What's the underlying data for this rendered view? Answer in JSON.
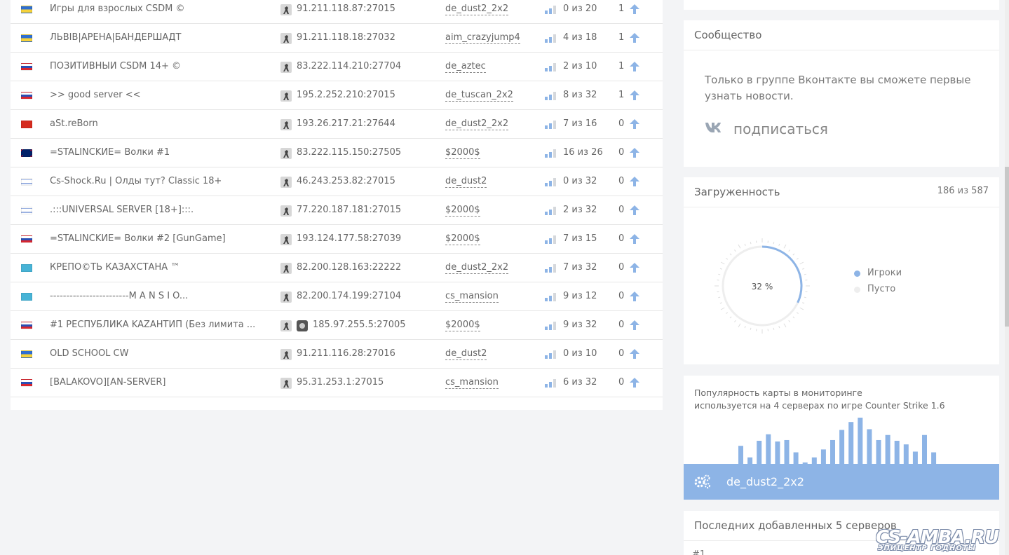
{
  "servers": [
    {
      "flag": "ua",
      "name": "Игры для взрослых CSDM ©",
      "ip": "91.211.118.87:27015",
      "map": "de_dust2_2x2",
      "players": "0 из 20",
      "rating": "1",
      "steam": false
    },
    {
      "flag": "ua",
      "name": "ЛЬВІВ|АРЕНА|БАНДЕРШАДТ",
      "ip": "91.211.118.18:27032",
      "map": "aim_crazyjump4",
      "players": "4 из 18",
      "rating": "1",
      "steam": false
    },
    {
      "flag": "ru",
      "name": "ПОЗИТИВНЫЙ CSDM 14+ ©",
      "ip": "83.222.114.210:27704",
      "map": "de_aztec",
      "players": "2 из 10",
      "rating": "1",
      "steam": false
    },
    {
      "flag": "ru",
      "name": ">> good server <<",
      "ip": "195.2.252.210:27015",
      "map": "de_tuscan_2x2",
      "players": "8 из 32",
      "rating": "1",
      "steam": false
    },
    {
      "flag": "ch",
      "name": "aSt.reBorn",
      "ip": "193.26.217.21:27644",
      "map": "de_dust2_2x2",
      "players": "7 из 16",
      "rating": "0",
      "steam": false
    },
    {
      "flag": "gb",
      "name": "=STALINCKИE= Волки #1",
      "ip": "83.222.115.150:27505",
      "map": "$2000$",
      "players": "16 из 26",
      "rating": "0",
      "steam": false
    },
    {
      "flag": "il",
      "name": "Cs-Shock.Ru | Олды тут? Classic 18+",
      "ip": "46.243.253.82:27015",
      "map": "de_dust2",
      "players": "0 из 32",
      "rating": "0",
      "steam": false
    },
    {
      "flag": "il",
      "name": ".:::UNIVERSAL SERVER [18+]:::.",
      "ip": "77.220.187.181:27015",
      "map": "$2000$",
      "players": "2 из 32",
      "rating": "0",
      "steam": false
    },
    {
      "flag": "ru",
      "name": "=STALINCKИE= Волки #2 [GunGame]",
      "ip": "193.124.177.58:27039",
      "map": "$2000$",
      "players": "7 из 15",
      "rating": "0",
      "steam": false
    },
    {
      "flag": "kz",
      "name": "КРЕПО©ТЬ КАЗАХСТАНА ™",
      "ip": "82.200.128.163:22222",
      "map": "de_dust2_2x2",
      "players": "7 из 32",
      "rating": "0",
      "steam": false
    },
    {
      "flag": "kz",
      "name": "------------------------M A N S I O...",
      "ip": "82.200.174.199:27104",
      "map": "cs_mansion",
      "players": "9 из 12",
      "rating": "0",
      "steam": false
    },
    {
      "flag": "ru",
      "name": "#1 РЕСПУБЛИКА KAZАНТИП (Без лимита ...",
      "ip": "185.97.255.5:27005",
      "map": "$2000$",
      "players": "9 из 32",
      "rating": "0",
      "steam": true
    },
    {
      "flag": "ua",
      "name": "OLD SCHOOL CW",
      "ip": "91.211.116.28:27016",
      "map": "de_dust2",
      "players": "0 из 10",
      "rating": "0",
      "steam": false
    },
    {
      "flag": "ru",
      "name": "[BALAKOVO][AN-SERVER]",
      "ip": "95.31.253.1:27015",
      "map": "cs_mansion",
      "players": "6 из 32",
      "rating": "0",
      "steam": false
    }
  ],
  "community": {
    "title": "Сообщество",
    "text": "Только в группе Вконтакте вы сможете первые узнать новости.",
    "subscribe": "подписаться",
    "icon": "vk-icon"
  },
  "load": {
    "title": "Загруженность",
    "count": "186 из 587",
    "percent_label": "32 %",
    "fraction": 0.32,
    "legend": [
      {
        "label": "Игроки",
        "color": "#8db4e6"
      },
      {
        "label": "Пусто",
        "color": "#eeeeee"
      }
    ]
  },
  "popularity": {
    "line1": "Популярность карты в мониторинге",
    "line2": "используется на 4 серверах по игре Counter Strike 1.6",
    "map": "de_dust2_2x2",
    "histogram": [
      25,
      9,
      32,
      41,
      31,
      33,
      16,
      2,
      9,
      20,
      33,
      47,
      58,
      64,
      48,
      33,
      40,
      32,
      27,
      17,
      40,
      16
    ],
    "icon": "gears-icon"
  },
  "recent": {
    "title": "Последних добавленных 5 серверов",
    "peek": "#1"
  },
  "watermark": {
    "big": "CS-AMBA.RU",
    "small": "ЭПИЦЕНТР ГОДНОТЫ"
  },
  "colors": {
    "accent": "#8db4e6",
    "bar_empty": "#d5d8dc"
  }
}
